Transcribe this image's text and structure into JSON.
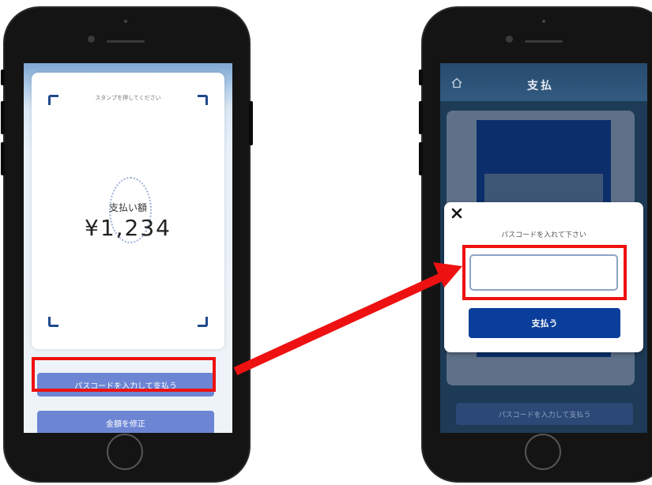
{
  "left_phone": {
    "stamp_hint": "スタンプを押してください",
    "amount_label": "支払い額",
    "amount_value": "¥1,234",
    "passcode_button": "パスコードを入力して支払う",
    "edit_amount_button": "金額を修正"
  },
  "right_phone": {
    "header_title": "支払",
    "background_button": "パスコードを入力して支払う",
    "modal": {
      "title": "パスコードを入れて下さい",
      "passcode_value": "",
      "pay_button": "支払う"
    }
  },
  "colors": {
    "highlight": "#ee1111",
    "primary_button": "#6c86d4",
    "pay_button": "#0b3e9b",
    "corner_accent": "#1f4a8c"
  }
}
